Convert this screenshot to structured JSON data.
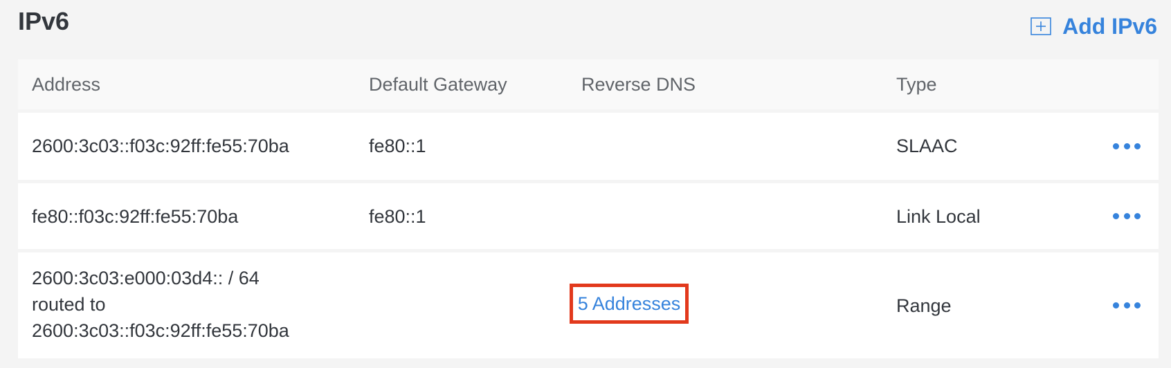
{
  "section": {
    "title": "IPv6"
  },
  "actions": {
    "add_label": "Add IPv6"
  },
  "table": {
    "headers": {
      "address": "Address",
      "gateway": "Default Gateway",
      "rdns": "Reverse DNS",
      "type": "Type"
    },
    "rows": [
      {
        "address": "2600:3c03::f03c:92ff:fe55:70ba",
        "gateway": "fe80::1",
        "rdns": "",
        "type": "SLAAC"
      },
      {
        "address": "fe80::f03c:92ff:fe55:70ba",
        "gateway": "fe80::1",
        "rdns": "",
        "type": "Link Local"
      },
      {
        "address_lines": [
          "2600:3c03:e000:03d4:: / 64",
          "routed to",
          "2600:3c03::f03c:92ff:fe55:70ba"
        ],
        "gateway": "",
        "rdns": "5 Addresses",
        "type": "Range"
      }
    ]
  },
  "colors": {
    "accent": "#3683dc",
    "highlight_border": "#e2391c",
    "text": "#32363c",
    "muted_text": "#606469",
    "page_bg": "#f4f4f4",
    "header_bg": "#f9f9f9",
    "row_bg": "#ffffff"
  },
  "icons": {
    "add": "plus-square-icon",
    "menu": "ellipsis-icon"
  }
}
